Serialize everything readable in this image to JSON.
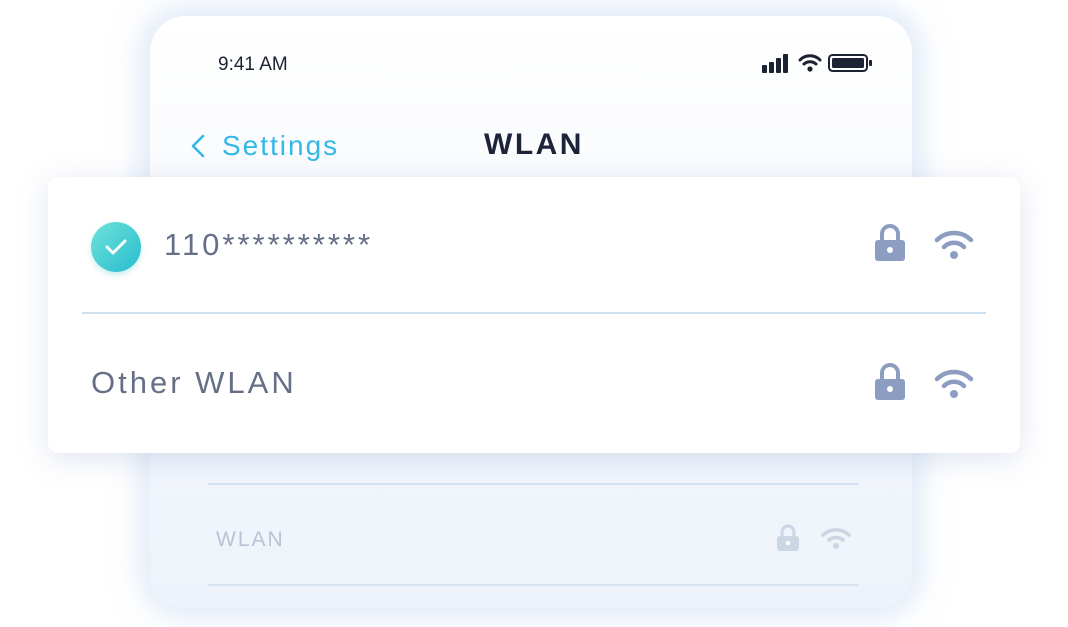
{
  "status_bar": {
    "time": "9:41 AM",
    "icons": [
      "signal-icon",
      "wifi-icon",
      "battery-icon"
    ]
  },
  "nav": {
    "back_label": "Settings",
    "title": "WLAN"
  },
  "networks": [
    {
      "name": "110**********",
      "connected": true,
      "secured": true
    },
    {
      "name": "Other WLAN",
      "connected": false,
      "secured": true
    }
  ],
  "background_list": {
    "item_label": "WLAN"
  },
  "colors": {
    "accent": "#33b8e8",
    "check": "#27bccf",
    "icon": "#8d9dc1",
    "text": "#656f85",
    "title": "#1d2338"
  }
}
